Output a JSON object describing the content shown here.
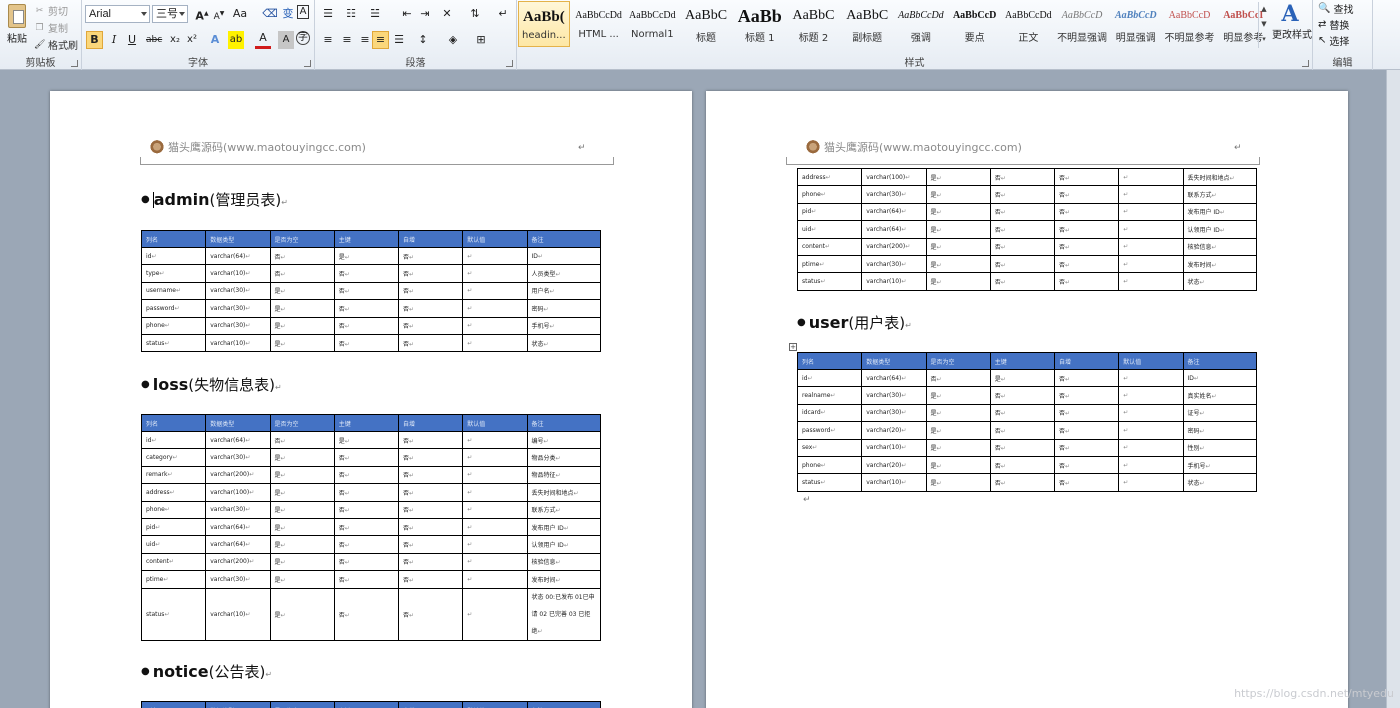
{
  "ribbon": {
    "clipboard": {
      "paste": "粘贴",
      "cut": "剪切",
      "copy": "复制",
      "format_painter": "格式刷",
      "label": "剪贴板"
    },
    "font": {
      "name": "Arial",
      "size": "三号",
      "label": "字体",
      "row1": [
        "A",
        "A",
        "Aa",
        "变",
        "A"
      ],
      "row2": [
        "B",
        "I",
        "U",
        "abc",
        "x₂",
        "x²",
        "A",
        "A",
        "A",
        "A",
        "字"
      ]
    },
    "paragraph": {
      "label": "段落"
    },
    "styles": {
      "label": "样式",
      "items": [
        {
          "preview": "AaBb(",
          "name": "headin...",
          "size": 15,
          "bold": true,
          "selected": true
        },
        {
          "preview": "AaBbCcDd",
          "name": "HTML ...",
          "size": 10
        },
        {
          "preview": "AaBbCcDd",
          "name": "Normal1",
          "size": 10
        },
        {
          "preview": "AaBbC",
          "name": "标题",
          "size": 14
        },
        {
          "preview": "AaBb",
          "name": "标题 1",
          "size": 18,
          "bold": true
        },
        {
          "preview": "AaBbC",
          "name": "标题 2",
          "size": 14
        },
        {
          "preview": "AaBbC",
          "name": "副标题",
          "size": 14
        },
        {
          "preview": "AaBbCcDd",
          "name": "强调",
          "size": 10,
          "italic": true
        },
        {
          "preview": "AaBbCcD",
          "name": "要点",
          "size": 10,
          "bold": true
        },
        {
          "preview": "AaBbCcDd",
          "name": "正文",
          "size": 10
        },
        {
          "preview": "AaBbCcD",
          "name": "不明显强调",
          "size": 10,
          "italic": true,
          "color": "#777777"
        },
        {
          "preview": "AaBbCcD",
          "name": "明显强调",
          "size": 10,
          "italic": true,
          "bold": true,
          "color": "#4f81bd"
        },
        {
          "preview": "AaBbCcD",
          "name": "不明显参考",
          "size": 10,
          "color": "#c0504d"
        },
        {
          "preview": "AaBbCcI",
          "name": "明显参考",
          "size": 10,
          "bold": true,
          "color": "#c0504d"
        }
      ],
      "change": "更改样式"
    },
    "editing": {
      "find": "查找",
      "replace": "替换",
      "select": "选择",
      "label": "编辑"
    }
  },
  "pages": {
    "header_text": "猫头鹰源码(www.maotouyingcc.com)",
    "col_headers": [
      "列名",
      "数据类型",
      "是否为空",
      "主键",
      "自增",
      "默认值",
      "备注"
    ],
    "page1": {
      "sections": [
        {
          "name": "admin",
          "cn": "(管理员表)",
          "rows": [
            [
              "id",
              "varchar(64)",
              "否",
              "是",
              "否",
              "",
              "ID"
            ],
            [
              "type",
              "varchar(10)",
              "否",
              "否",
              "否",
              "",
              "人员类型"
            ],
            [
              "username",
              "varchar(30)",
              "是",
              "否",
              "否",
              "",
              "用户名"
            ],
            [
              "password",
              "varchar(30)",
              "是",
              "否",
              "否",
              "",
              "密码"
            ],
            [
              "phone",
              "varchar(30)",
              "是",
              "否",
              "否",
              "",
              "手机号"
            ],
            [
              "status",
              "varchar(10)",
              "是",
              "否",
              "否",
              "",
              "状态"
            ]
          ]
        },
        {
          "name": "loss",
          "cn": "(失物信息表)",
          "rows": [
            [
              "id",
              "varchar(64)",
              "否",
              "是",
              "否",
              "",
              "编号"
            ],
            [
              "category",
              "varchar(30)",
              "是",
              "否",
              "否",
              "",
              "物品分类"
            ],
            [
              "remark",
              "varchar(200)",
              "是",
              "否",
              "否",
              "",
              "物品特征"
            ],
            [
              "address",
              "varchar(100)",
              "是",
              "否",
              "否",
              "",
              "丢失时间和地点"
            ],
            [
              "phone",
              "varchar(30)",
              "是",
              "否",
              "否",
              "",
              "联系方式"
            ],
            [
              "pid",
              "varchar(64)",
              "是",
              "否",
              "否",
              "",
              "发布用户 ID"
            ],
            [
              "uid",
              "varchar(64)",
              "是",
              "否",
              "否",
              "",
              "认领用户 ID"
            ],
            [
              "content",
              "varchar(200)",
              "是",
              "否",
              "否",
              "",
              "核验信息"
            ],
            [
              "ptime",
              "varchar(30)",
              "是",
              "否",
              "否",
              "",
              "发布时间"
            ],
            [
              "status",
              "varchar(10)",
              "是",
              "否",
              "否",
              "",
              "状态 00:已发布 01已申请 02 已完善 03 已拒绝"
            ]
          ]
        },
        {
          "name": "notice",
          "cn": "(公告表)",
          "rows": []
        }
      ]
    },
    "page2": {
      "continued_rows": [
        [
          "address",
          "varchar(100)",
          "是",
          "否",
          "否",
          "",
          "丢失时间和地点"
        ],
        [
          "phone",
          "varchar(30)",
          "是",
          "否",
          "否",
          "",
          "联系方式"
        ],
        [
          "pid",
          "varchar(64)",
          "是",
          "否",
          "否",
          "",
          "发布用户 ID"
        ],
        [
          "uid",
          "varchar(64)",
          "是",
          "否",
          "否",
          "",
          "认领用户 ID"
        ],
        [
          "content",
          "varchar(200)",
          "是",
          "否",
          "否",
          "",
          "核验信息"
        ],
        [
          "ptime",
          "varchar(30)",
          "是",
          "否",
          "否",
          "",
          "发布时间"
        ],
        [
          "status",
          "varchar(10)",
          "是",
          "否",
          "否",
          "",
          "状态"
        ]
      ],
      "sections": [
        {
          "name": "user",
          "cn": "(用户表)",
          "rows": [
            [
              "id",
              "varchar(64)",
              "否",
              "是",
              "否",
              "",
              "ID"
            ],
            [
              "realname",
              "varchar(30)",
              "是",
              "否",
              "否",
              "",
              "真实姓名"
            ],
            [
              "idcard",
              "varchar(30)",
              "是",
              "否",
              "否",
              "",
              "证号"
            ],
            [
              "password",
              "varchar(20)",
              "是",
              "否",
              "否",
              "",
              "密码"
            ],
            [
              "sex",
              "varchar(10)",
              "是",
              "否",
              "否",
              "",
              "性别"
            ],
            [
              "phone",
              "varchar(20)",
              "是",
              "否",
              "否",
              "",
              "手机号"
            ],
            [
              "status",
              "varchar(10)",
              "是",
              "否",
              "否",
              "",
              "状态"
            ]
          ]
        }
      ]
    }
  },
  "watermark": "https://blog.csdn.net/mtyedu"
}
